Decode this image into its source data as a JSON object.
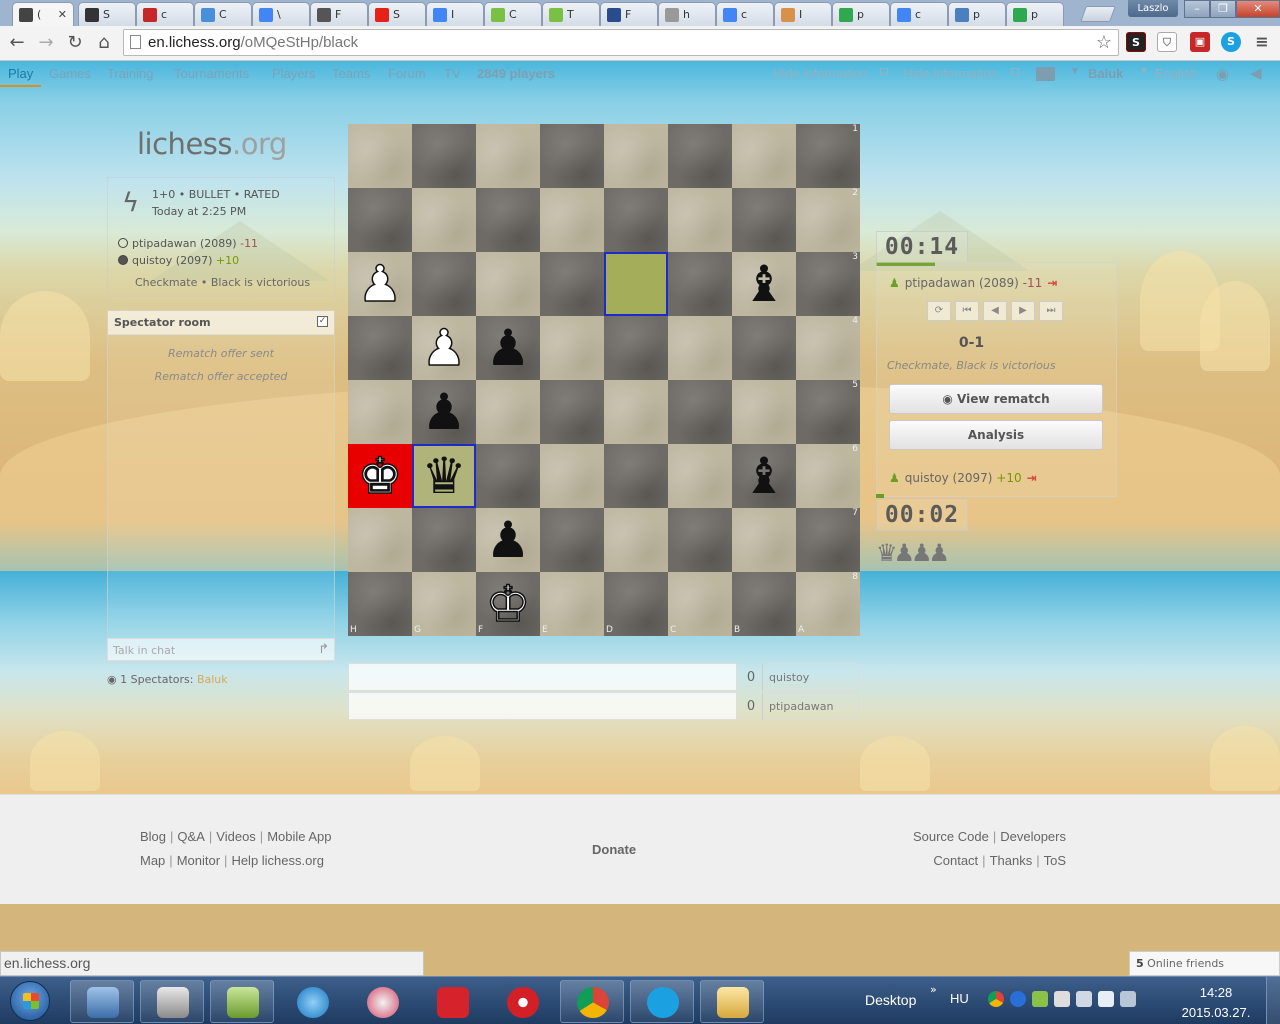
{
  "browser": {
    "tabs": [
      {
        "label": "(",
        "fav": "lichess-icon",
        "color": "#444444"
      },
      {
        "label": "S",
        "fav": "s-icon",
        "color": "#333333"
      },
      {
        "label": "c",
        "fav": "red-icon",
        "color": "#c62828"
      },
      {
        "label": "C",
        "fav": "c-icon",
        "color": "#4a90d9"
      },
      {
        "label": "\\",
        "fav": "google-icon",
        "color": "#4285f4"
      },
      {
        "label": "F",
        "fav": "cow-icon",
        "color": "#555555"
      },
      {
        "label": "S",
        "fav": "youtube-icon",
        "color": "#e62117"
      },
      {
        "label": "I",
        "fav": "google-icon",
        "color": "#4285f4"
      },
      {
        "label": "C",
        "fav": "green-icon",
        "color": "#7ac143"
      },
      {
        "label": "T",
        "fav": "green-icon",
        "color": "#7ac143"
      },
      {
        "label": "F",
        "fav": "globe-icon",
        "color": "#2a4c8c"
      },
      {
        "label": "h",
        "fav": "page-icon",
        "color": "#999999"
      },
      {
        "label": "c",
        "fav": "google-icon",
        "color": "#4285f4"
      },
      {
        "label": "I",
        "fav": "hand-icon",
        "color": "#d9904a"
      },
      {
        "label": "p",
        "fav": "chat-icon",
        "color": "#2fa84f"
      },
      {
        "label": "c",
        "fav": "google-icon",
        "color": "#4285f4"
      },
      {
        "label": "p",
        "fav": "d-icon",
        "color": "#4a7fc0"
      },
      {
        "label": "p",
        "fav": "chat-icon",
        "color": "#2fa84f"
      }
    ],
    "window_user": "Laszlo",
    "url_host": "en.lichess.org",
    "url_path": "/oMQeStHp/black"
  },
  "nav": {
    "items": [
      "Play",
      "Games",
      "Training",
      "Tournaments",
      "Players",
      "Teams",
      "Forum",
      "TV"
    ],
    "player_count": "2849 players",
    "hide_info_1": "Hide information",
    "hide_info_2": "Hide information",
    "user": "Baluk",
    "language": "English"
  },
  "logo": {
    "name": "lichess",
    "tld": ".org"
  },
  "game": {
    "line1": "1+0 • BULLET • RATED",
    "line2": "Today at 2:25 PM",
    "white_player": "ptipadawan (2089)",
    "white_diff": "-11",
    "black_player": "quistoy (2097)",
    "black_diff": "+10",
    "result": "Checkmate • Black is victorious"
  },
  "spectator": {
    "title": "Spectator room",
    "messages": [
      "Rematch offer sent",
      "Rematch offer accepted"
    ],
    "chat_placeholder": "Talk in chat",
    "spectators_label": "1 Spectators:",
    "spectators_name": "Baluk"
  },
  "board": {
    "ranks": [
      "1",
      "2",
      "3",
      "4",
      "5",
      "6",
      "7",
      "8"
    ],
    "files": [
      "H",
      "G",
      "F",
      "E",
      "D",
      "C",
      "B",
      "A"
    ],
    "pieces": [
      {
        "row": 2,
        "col": 0,
        "glyph": "♟",
        "color": "w"
      },
      {
        "row": 2,
        "col": 6,
        "glyph": "♝",
        "color": "b"
      },
      {
        "row": 3,
        "col": 1,
        "glyph": "♟",
        "color": "w"
      },
      {
        "row": 3,
        "col": 2,
        "glyph": "♟",
        "color": "b"
      },
      {
        "row": 4,
        "col": 1,
        "glyph": "♟",
        "color": "b"
      },
      {
        "row": 5,
        "col": 0,
        "glyph": "♚",
        "color": "w"
      },
      {
        "row": 5,
        "col": 1,
        "glyph": "♛",
        "color": "b"
      },
      {
        "row": 5,
        "col": 6,
        "glyph": "♝",
        "color": "b"
      },
      {
        "row": 6,
        "col": 2,
        "glyph": "♟",
        "color": "b"
      },
      {
        "row": 7,
        "col": 2,
        "glyph": "♔",
        "color": "w"
      }
    ]
  },
  "right": {
    "clock_top": "00:14",
    "clock_bottom": "00:02",
    "top_player": "ptipadawan (2089)",
    "top_diff": "-11",
    "bottom_player": "quistoy (2097)",
    "bottom_diff": "+10",
    "score": "0-1",
    "status": "Checkmate, Black is victorious",
    "view_rematch": "View rematch",
    "analysis": "Analysis",
    "captured": "♛♟♟♟"
  },
  "replay": [
    {
      "num": "0",
      "name": "quistoy"
    },
    {
      "num": "0",
      "name": "ptipadawan"
    }
  ],
  "footer": {
    "left_row1": [
      "Blog",
      "Q&A",
      "Videos",
      "Mobile App"
    ],
    "left_row2": [
      "Map",
      "Monitor",
      "Help lichess.org"
    ],
    "donate": "Donate",
    "right_row1": [
      "Source Code",
      "Developers"
    ],
    "right_row2": [
      "Contact",
      "Thanks",
      "ToS"
    ]
  },
  "status_url": "en.lichess.org",
  "friends": {
    "count": "5",
    "label": " Online friends"
  },
  "taskbar": {
    "desktop": "Desktop",
    "lang": "HU",
    "time": "14:28",
    "date": "2015.03.27."
  },
  "colors": {
    "accent": "#d59120",
    "check": "#e80000",
    "lastmove": "#1e2bcc",
    "positive": "#759900"
  }
}
